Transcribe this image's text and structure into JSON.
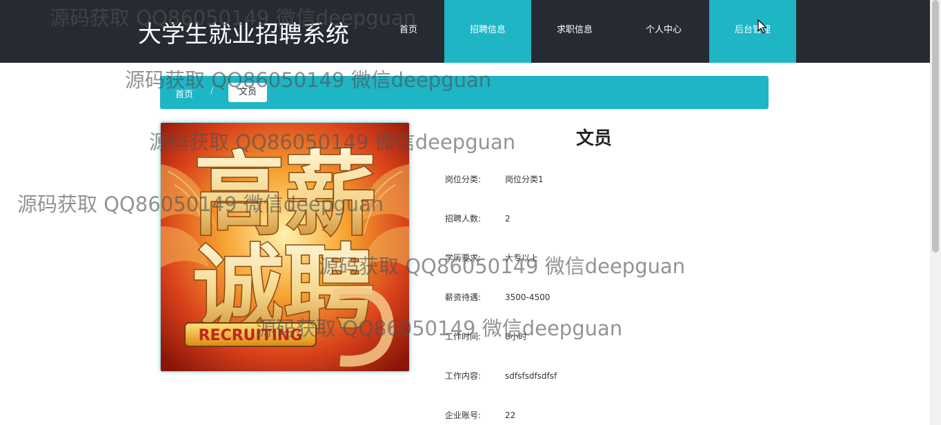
{
  "header": {
    "site_title": "大学生就业招聘系统",
    "nav": [
      {
        "label": "首页",
        "active": false
      },
      {
        "label": "招聘信息",
        "active": true
      },
      {
        "label": "求职信息",
        "active": false
      },
      {
        "label": "个人中心",
        "active": false
      },
      {
        "label": "后台管理",
        "active": true
      }
    ]
  },
  "breadcrumb": {
    "home": "首页",
    "separator": "/",
    "current": "文员"
  },
  "job": {
    "title": "文员",
    "poster_text_line1": "高薪",
    "poster_text_line2": "诚聘",
    "poster_banner": "RECRUITING",
    "fields": [
      {
        "label": "岗位分类:",
        "value": "岗位分类1"
      },
      {
        "label": "招聘人数:",
        "value": "2"
      },
      {
        "label": "学历要求:",
        "value": "大专以上"
      },
      {
        "label": "薪资待遇:",
        "value": "3500-4500"
      },
      {
        "label": "工作时间:",
        "value": "8小时"
      },
      {
        "label": "工作内容:",
        "value": "sdfsfsdfsdfsf"
      },
      {
        "label": "企业账号:",
        "value": "22"
      }
    ]
  },
  "watermark": "源码获取 QQ86050149 微信deepguan",
  "colors": {
    "header_bg": "#262b33",
    "accent": "#1eb5c5",
    "page_bg": "#ffffff"
  }
}
